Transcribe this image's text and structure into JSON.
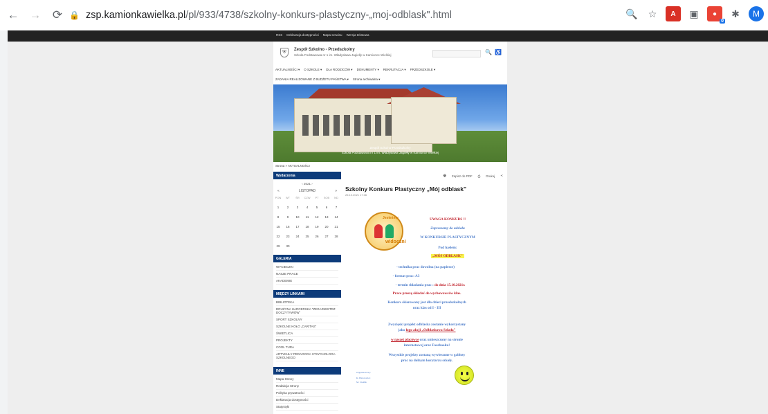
{
  "browser": {
    "back_icon": "back-arrow-icon",
    "url_host": "zsp.kamionkawielka.pl",
    "url_path": "/pl/933/4738/szkolny-konkurs-plastyczny-„moj-odblask\".html",
    "avatar_initial": "M",
    "ext_badge": "0"
  },
  "topbar": {
    "links": [
      "RSS",
      "Deklaracja dostępności",
      "Mapa serwisu",
      "Wersja tekstowa"
    ]
  },
  "header": {
    "school_name": "Zespół Szkolno - Przedszkolny",
    "school_sub": "Szkoła Podstawowa nr 1 im. Władysława Jagiełły w Kamionce Wielkiej"
  },
  "menu": {
    "row1": [
      "AKTUALNOŚCI ▾",
      "O SZKOLE ▾",
      "DLA RODZICÓW ▾",
      "DOKUMENTY ▾",
      "REKRUTACJA ▾",
      "PRZEDSZKOLE ▾"
    ],
    "row2": [
      "ZADANIA REALIZOWANE Z BUDŻETU PAŃSTWA ▾",
      "Strona archiwalna ▾"
    ]
  },
  "hero": {
    "caption_line1": "Zespół Szkolno-Przedszkolny",
    "caption_line2": "Szkoła Podstawowa nr 1 im. Władysława Jagiełły w Kamionce Wielkiej"
  },
  "breadcrumb": "Strona » AKTUALNOŚCI",
  "calendar": {
    "head": "Wydarzenia",
    "year": "‹  2021  ›",
    "month": "LISTOPAD",
    "prev": "«",
    "next": "»",
    "weekdays": [
      "PON",
      "WT",
      "ŚR",
      "CZW",
      "PT",
      "SOB",
      "ND"
    ],
    "days": [
      "1",
      "2",
      "3",
      "4",
      "5",
      "6",
      "7",
      "8",
      "9",
      "10",
      "11",
      "12",
      "13",
      "14",
      "15",
      "16",
      "17",
      "18",
      "19",
      "20",
      "21",
      "22",
      "23",
      "24",
      "25",
      "26",
      "27",
      "28",
      "29",
      "30"
    ]
  },
  "galeria": {
    "head": "GALERIA",
    "items": [
      "WYCIECZKI",
      "NASZE PRACE",
      "AKADEMIE"
    ]
  },
  "links": {
    "head": "MIĘDZY LINKAMI",
    "items": [
      "BIBLIOTEKA",
      "DRUŻYNA HARCERSKA \"ZEGARMISTRZ DOCZYTYWÓW\"",
      "SPORT SZKOLNY",
      "SZKOLNE KOŁO „CARITAS\"",
      "ŚWIETLICA",
      "PROJEKTY",
      "COOL TURA",
      "ARTYKUŁY PEDAGOGA I PSYCHOLOGA SZKOLNEGO"
    ]
  },
  "inne": {
    "head": "INNE",
    "items": [
      "Mapa Strony",
      "Redakcja Strony",
      "Polityka prywatności",
      "Deklaracja dostępności",
      "Statystyki"
    ]
  },
  "article": {
    "share": [
      "Zapisz do PDF",
      "Drukuj"
    ],
    "title": "Szkolny Konkurs Plastyczny „Mój odblask\"",
    "date": "26.10.2021 17:36"
  },
  "poster": {
    "logo_top": "Jesteśmy",
    "logo_bottom": "widoczni",
    "l1": "UWAGA KONKURS !!",
    "l2": "Zapraszamy do udziału",
    "l3": "W KONKURSIE PLASTYCZNYM",
    "l4": "Pod hasłem:",
    "l5": "„MÓJ ODBLASK\"",
    "l6": "- technika prac dowolna (na papierze)",
    "l7": "- format prac: A3",
    "l8a": "- termin składania prac :",
    "l8b": "do dnia 15.10.2021r.",
    "l9": "Prace proszę składać do wychowawców klas.",
    "l10": "Konkurs skierowany jest dla dzieci przedszkolnych",
    "l11": "oraz klas od I - III",
    "l12": "Zwycięski projekt odblaska zostanie wykorzystany",
    "l13a": "jako",
    "l13b": "logo akcji „Odblaskowa Szkoła\"",
    "l14a": "w naszej placówce",
    "l14b": "oraz umieszczony na stronie",
    "l15": "internetowej oraz Facebooku!",
    "l16": "Wszystkie projekty zostaną wywieszone w gabloty",
    "l17": "prac na dolnym korytarzu szkoły.",
    "sign1": "Organizatorzy:",
    "sign2": "K. Batorowicz",
    "sign3": "M. Cieślik"
  }
}
